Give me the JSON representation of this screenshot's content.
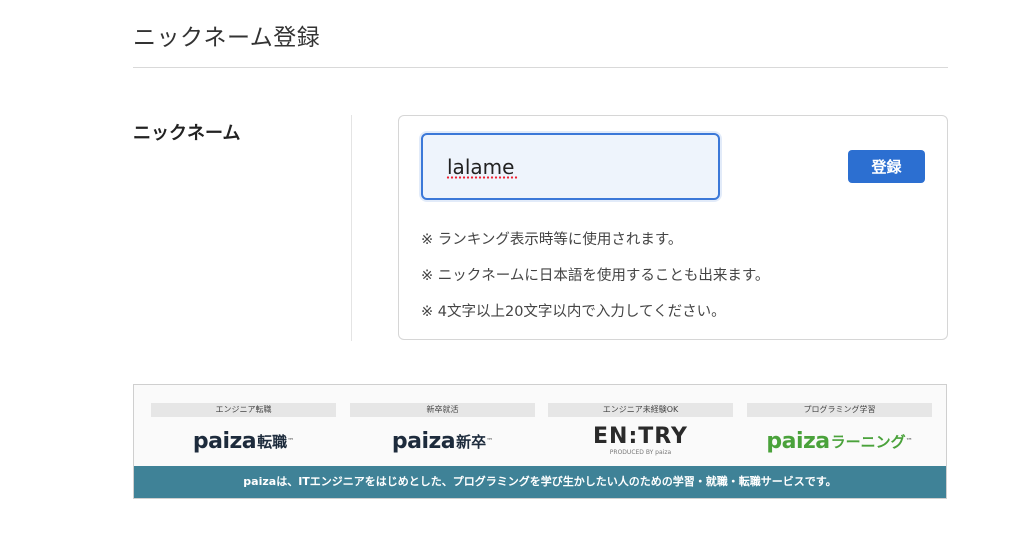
{
  "page": {
    "title": "ニックネーム登録"
  },
  "form": {
    "label": "ニックネーム",
    "nickname_value": "lalame",
    "submit_label": "登録",
    "notes": [
      "※ ランキング表示時等に使用されます。",
      "※ ニックネームに日本語を使用することも出来ます。",
      "※ 4文字以上20文字以内で入力してください。"
    ]
  },
  "banner": {
    "services": [
      {
        "tag": "エンジニア転職",
        "logo": "paiza",
        "suffix": "転職"
      },
      {
        "tag": "新卒就活",
        "logo": "paiza",
        "suffix": "新卒"
      },
      {
        "tag": "エンジニア未経験OK",
        "logo": "EN:TRY",
        "sub": "PRODUCED BY paiza"
      },
      {
        "tag": "プログラミング学習",
        "logo": "paiza",
        "suffix": "ラーニング"
      }
    ],
    "footer": "paizaは、ITエンジニアをはじめとした、プログラミングを学び生かしたい人のための学習・就職・転職サービスです。"
  },
  "colors": {
    "primary": "#2c6fd1",
    "banner_footer": "#3f8297",
    "learning_green": "#4aa23b"
  }
}
